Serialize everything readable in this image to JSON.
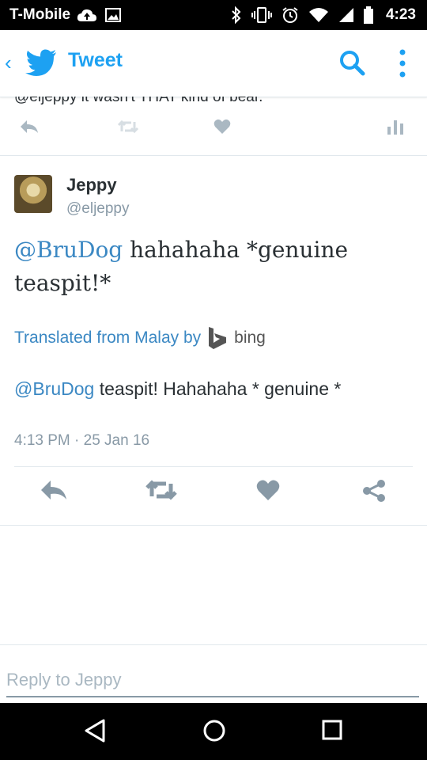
{
  "status_bar": {
    "carrier": "T-Mobile",
    "time": "4:23",
    "icons": [
      "cloud-upload-icon",
      "image-icon",
      "bluetooth-icon",
      "vibrate-icon",
      "alarm-icon",
      "wifi-icon",
      "signal-icon",
      "battery-icon"
    ]
  },
  "app_bar": {
    "title": "Tweet",
    "back_icon": "chevron-left-icon",
    "logo_icon": "twitter-bird-icon",
    "actions": [
      "search-icon",
      "more-vert-icon"
    ]
  },
  "previous_tweet": {
    "text": "@eljeppy it wasn't THAT kind of bear.",
    "actions": [
      "reply-icon",
      "retweet-icon",
      "like-icon",
      "analytics-icon"
    ]
  },
  "tweet": {
    "display_name": "Jeppy",
    "handle": "@eljeppy",
    "text_mention": "@BruDog",
    "text_body": " hahahaha *genuine teaspit!*",
    "translated_label": "Translated from Malay by",
    "translator_name": "bing",
    "translation_mention": "@BruDog",
    "translation_body": " teaspit! Hahahaha * genuine *",
    "timestamp": "4:13 PM · 25 Jan 16",
    "actions": [
      "reply-icon",
      "retweet-icon",
      "like-icon",
      "share-icon"
    ]
  },
  "reply": {
    "placeholder": "Reply to Jeppy"
  },
  "nav_bar": {
    "buttons": [
      "back-triangle-icon",
      "home-circle-icon",
      "recents-square-icon"
    ]
  },
  "colors": {
    "accent": "#1da1f2",
    "link": "#3b88c3",
    "muted": "#8899a6",
    "action_icon": "#aab8c2",
    "action_icon_main": "#8899a6"
  }
}
